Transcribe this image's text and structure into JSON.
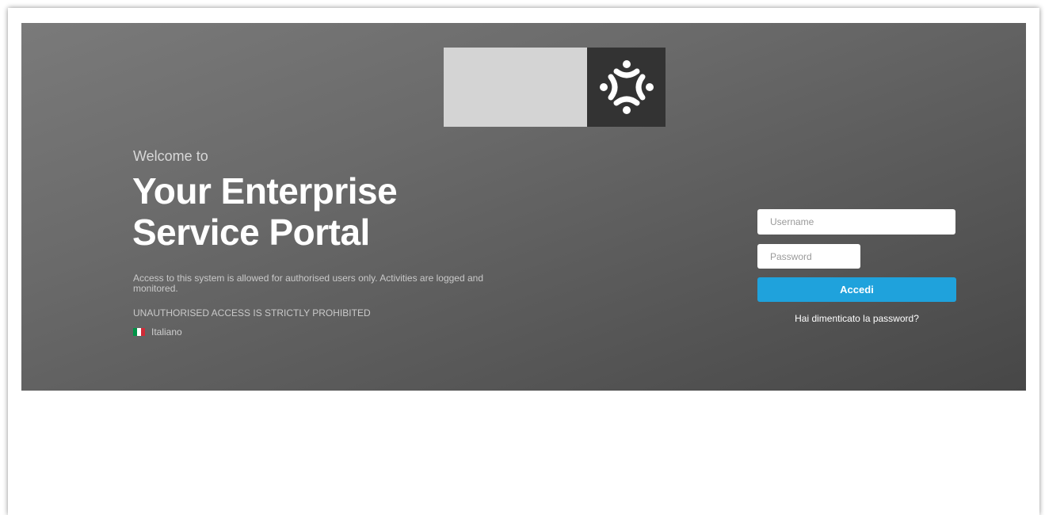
{
  "hero": {
    "welcome": "Welcome to",
    "title": "Your Enterprise Service Portal",
    "notice": "Access to this system is allowed for authorised users only. Activities are logged and monitored.",
    "warning": "UNAUTHORISED ACCESS IS STRICTLY PROHIBITED",
    "language": {
      "label": "Italiano",
      "flag_colors": [
        "#009246",
        "#ffffff",
        "#ce2b37"
      ]
    }
  },
  "logo": {
    "icon": "people-circle-icon",
    "light_color": "#d4d4d4",
    "dark_color": "#333333"
  },
  "login": {
    "username_placeholder": "Username",
    "username_value": "",
    "password_placeholder": "Password",
    "password_value": "",
    "submit_label": "Accedi",
    "forgot_label": "Hai dimenticato la password?",
    "accent_color": "#1fa2dc"
  }
}
